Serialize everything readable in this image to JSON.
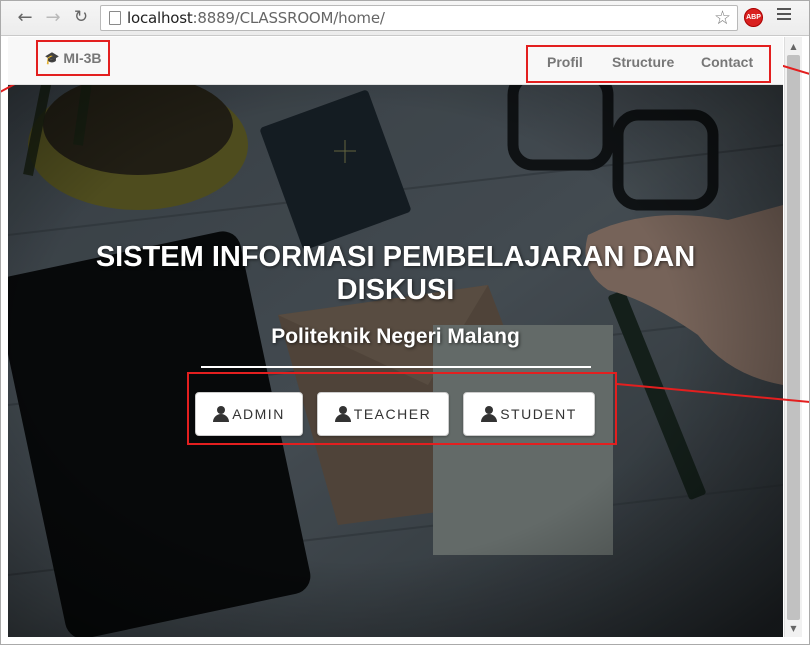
{
  "browser": {
    "url_host": "localhost",
    "url_rest": ":8889/CLASSROOM/home/",
    "icons": [
      "back-arrow-icon",
      "forward-arrow-icon",
      "reload-icon",
      "page-icon",
      "star-icon",
      "adblock-icon",
      "menu-icon"
    ],
    "adblock_label": "ABP"
  },
  "navbar": {
    "brand": "MI-3B",
    "brand_icon": "graduation-cap-icon",
    "links": [
      "Profil",
      "Structure",
      "Contact"
    ]
  },
  "hero": {
    "title_line1": "SISTEM INFORMASI PEMBELAJARAN DAN",
    "title_line2": "DISKUSI",
    "subtitle": "Politeknik Negeri Malang",
    "buttons": [
      "ADMIN",
      "TEACHER",
      "STUDENT"
    ],
    "button_icon": "user-icon"
  },
  "colors": {
    "annotation": "#e31f1f",
    "navbar_bg": "#f8f8f8",
    "nav_text": "#777777"
  }
}
